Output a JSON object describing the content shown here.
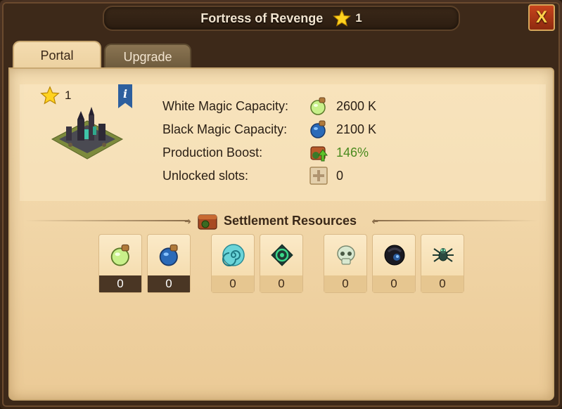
{
  "window": {
    "title": "Fortress of Revenge",
    "level": "1",
    "close_label": "X"
  },
  "tabs": [
    {
      "label": "Portal",
      "active": true
    },
    {
      "label": "Upgrade",
      "active": false
    }
  ],
  "building": {
    "level": "1",
    "info_label": "i"
  },
  "stats": [
    {
      "label": "White Magic Capacity:",
      "icon": "white-magic-potion-icon",
      "value": "2600 K"
    },
    {
      "label": "Black Magic Capacity:",
      "icon": "black-magic-potion-icon",
      "value": "2100 K"
    },
    {
      "label": "Production Boost:",
      "icon": "production-boost-icon",
      "value": "146%"
    },
    {
      "label": "Unlocked slots:",
      "icon": "slot-plus-icon",
      "value": "0"
    }
  ],
  "resources": {
    "title": "Settlement Resources",
    "items": [
      {
        "icon": "white-magic-potion-icon",
        "value": "0"
      },
      {
        "icon": "black-magic-potion-icon",
        "value": "0"
      },
      {
        "icon": "swirl-orb-icon",
        "value": "0"
      },
      {
        "icon": "green-rune-icon",
        "value": "0"
      },
      {
        "icon": "skull-icon",
        "value": "0"
      },
      {
        "icon": "dark-orb-icon",
        "value": "0"
      },
      {
        "icon": "spider-icon",
        "value": "0"
      }
    ]
  },
  "colors": {
    "accent_green": "#4a8a1e",
    "panel_bg": "#f1d6a8",
    "frame_dark": "#3d2919"
  }
}
